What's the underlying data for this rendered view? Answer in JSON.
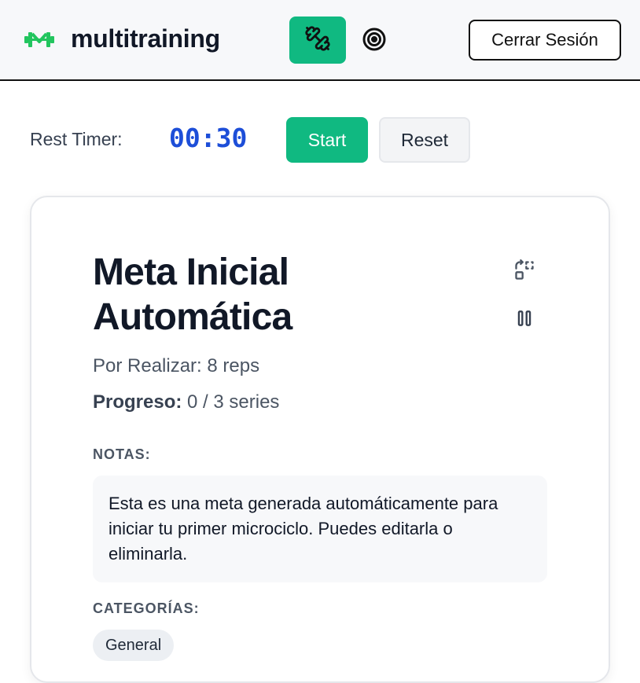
{
  "header": {
    "brand": "multitraining",
    "logo_icon": "dumbbell-m-logo-icon",
    "nav": [
      {
        "icon": "dumbbell-icon",
        "active": true
      },
      {
        "icon": "target-icon",
        "active": false
      }
    ],
    "logout_label": "Cerrar Sesión",
    "accent_color": "#10b981"
  },
  "timer": {
    "label": "Rest Timer:",
    "value": "00:30",
    "start_label": "Start",
    "reset_label": "Reset",
    "value_color": "#1d4ed8"
  },
  "goal": {
    "title": "Meta Inicial Automática",
    "actions": [
      {
        "icon": "rotate-select-icon"
      },
      {
        "icon": "pause-icon"
      }
    ],
    "pending_text": "Por Realizar: 8 reps",
    "progress_label": "Progreso:",
    "progress_value": "0 / 3 series",
    "notes_label": "NOTAS:",
    "notes": "Esta es una meta generada automáticamente para iniciar tu primer microciclo. Puedes editarla o eliminarla.",
    "categories_label": "CATEGORÍAS:",
    "categories": [
      "General"
    ]
  }
}
